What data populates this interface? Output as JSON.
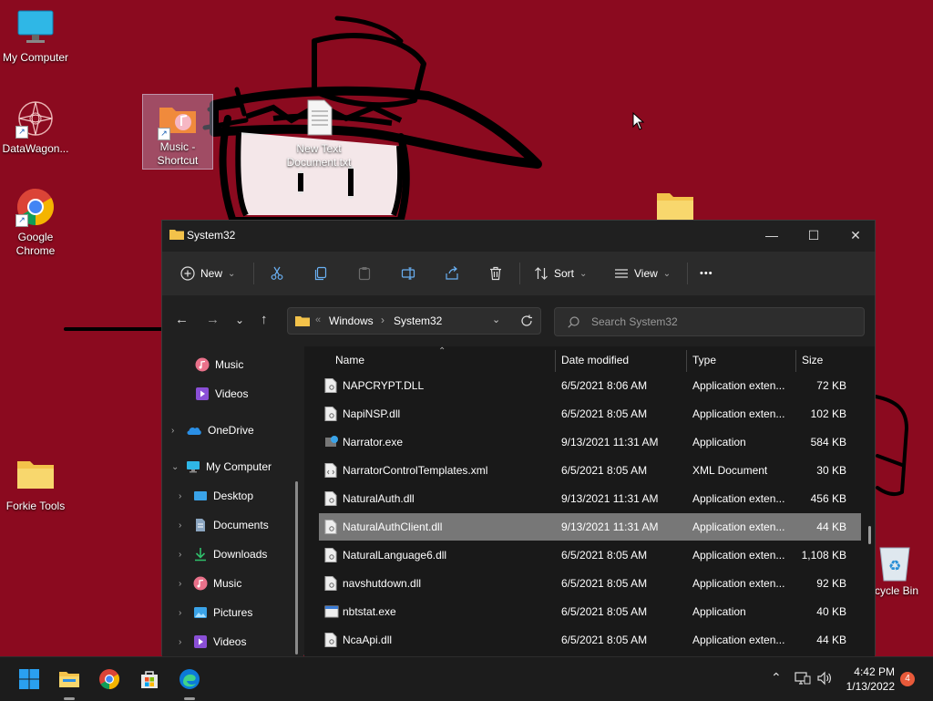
{
  "desktop": {
    "icons": [
      {
        "label": "My Computer"
      },
      {
        "label": "DataWagon..."
      },
      {
        "label": "Music -\nShortcut"
      },
      {
        "label": "New Text\nDocument.txt"
      },
      {
        "label": "Google\nChrome"
      },
      {
        "label": "Forkie Tools"
      },
      {
        "label": "cycle Bin"
      }
    ]
  },
  "window": {
    "title": "System32",
    "controls": {
      "minimize": "—",
      "maximize": "☐",
      "close": "✕"
    }
  },
  "toolbar": {
    "new_label": "New",
    "sort_label": "Sort",
    "view_label": "View",
    "more_label": "•••"
  },
  "address": {
    "crumbs": [
      "Windows",
      "System32"
    ],
    "overflow": "«"
  },
  "search": {
    "placeholder": "Search System32"
  },
  "sidebar": {
    "items": [
      {
        "label": "Music"
      },
      {
        "label": "Videos"
      },
      {
        "label": "OneDrive"
      },
      {
        "label": "My Computer"
      },
      {
        "label": "Desktop"
      },
      {
        "label": "Documents"
      },
      {
        "label": "Downloads"
      },
      {
        "label": "Music"
      },
      {
        "label": "Pictures"
      },
      {
        "label": "Videos"
      }
    ]
  },
  "filelist": {
    "columns": {
      "name": "Name",
      "date": "Date modified",
      "type": "Type",
      "size": "Size"
    },
    "rows": [
      {
        "name": "NAPCRYPT.DLL",
        "date": "6/5/2021 8:06 AM",
        "type": "Application exten...",
        "size": "72 KB"
      },
      {
        "name": "NapiNSP.dll",
        "date": "6/5/2021 8:05 AM",
        "type": "Application exten...",
        "size": "102 KB"
      },
      {
        "name": "Narrator.exe",
        "date": "9/13/2021 11:31 AM",
        "type": "Application",
        "size": "584 KB"
      },
      {
        "name": "NarratorControlTemplates.xml",
        "date": "6/5/2021 8:05 AM",
        "type": "XML Document",
        "size": "30 KB"
      },
      {
        "name": "NaturalAuth.dll",
        "date": "9/13/2021 11:31 AM",
        "type": "Application exten...",
        "size": "456 KB"
      },
      {
        "name": "NaturalAuthClient.dll",
        "date": "9/13/2021 11:31 AM",
        "type": "Application exten...",
        "size": "44 KB"
      },
      {
        "name": "NaturalLanguage6.dll",
        "date": "6/5/2021 8:05 AM",
        "type": "Application exten...",
        "size": "1,108 KB"
      },
      {
        "name": "navshutdown.dll",
        "date": "6/5/2021 8:05 AM",
        "type": "Application exten...",
        "size": "92 KB"
      },
      {
        "name": "nbtstat.exe",
        "date": "6/5/2021 8:05 AM",
        "type": "Application",
        "size": "40 KB"
      },
      {
        "name": "NcaApi.dll",
        "date": "6/5/2021 8:05 AM",
        "type": "Application exten...",
        "size": "44 KB"
      }
    ]
  },
  "taskbar": {
    "time": "4:42 PM",
    "date": "1/13/2022",
    "notifications": "4"
  },
  "colors": {
    "desktop_bg": "#8b0a1f",
    "window_bg": "#202020",
    "selected_row": "#777777",
    "folder": "#f3c24a"
  }
}
